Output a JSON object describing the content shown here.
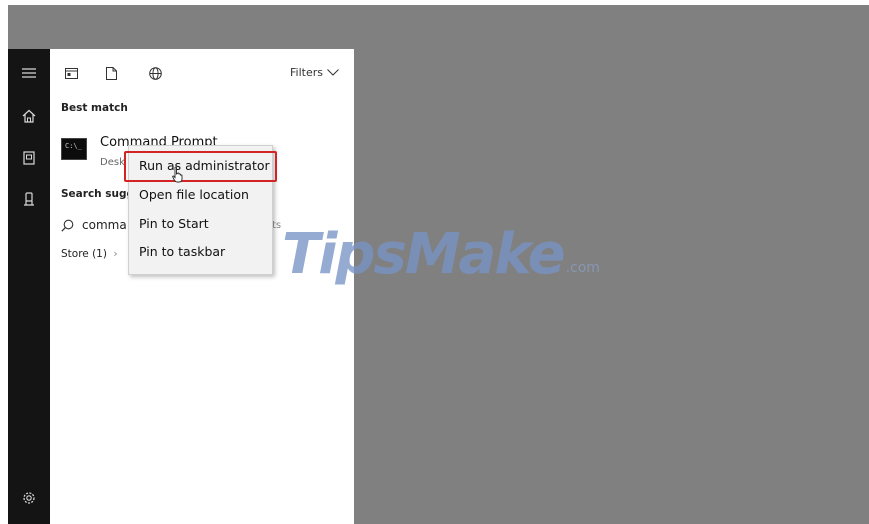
{
  "start_panel": {
    "toolbar": {
      "icons": [
        "apps-icon",
        "documents-icon",
        "web-icon"
      ],
      "filters_label": "Filters"
    },
    "best_match": {
      "title": "Best match",
      "app_name": "Command Prompt",
      "app_subtitle": "Desk",
      "app_icon_text": "C:\\_"
    },
    "search_suggestions": {
      "title": "Search sugge",
      "query": "comma",
      "trailing": "ts"
    },
    "store": {
      "label": "Store (1)",
      "chevron": "›"
    }
  },
  "context_menu": {
    "items": [
      {
        "label": "Run as administrator"
      },
      {
        "label": "Open file location"
      },
      {
        "label": "Pin to Start"
      },
      {
        "label": "Pin to taskbar"
      }
    ],
    "highlight_color": "#d32424"
  },
  "nav_rail": {
    "icons": [
      "hamburger-icon",
      "home-icon",
      "documents-icon",
      "contact-icon",
      "settings-icon"
    ]
  },
  "watermark": {
    "text": "TipsMake",
    "suffix": ".com"
  }
}
